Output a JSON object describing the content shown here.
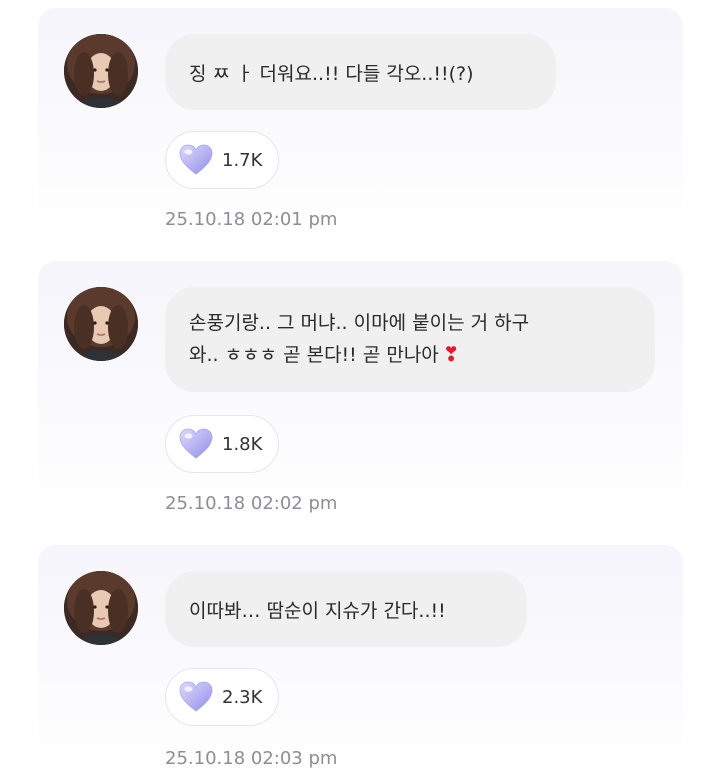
{
  "colors": {
    "card_background": "#f5f5fb",
    "bubble_background": "#f0f0f1",
    "timestamp_text": "#8e8e93",
    "reaction_heart": "#b7b4f4",
    "inline_heart": "#e8192c"
  },
  "messages": [
    {
      "lines": [
        "징 ㅉ ㅏ 더워요..!! 다들 각오..!!(?)"
      ],
      "reaction_icon": "lavender-heart-icon",
      "reaction_count": "1.7K",
      "timestamp": "25.10.18 02:01 pm"
    },
    {
      "lines": [
        "손풍기랑.. 그 머냐.. 이마에 붙이는 거 하구",
        "와.. ㅎㅎㅎ 곧 본다!! 곧 만나아"
      ],
      "trailing_emoji": "❣",
      "reaction_icon": "lavender-heart-icon",
      "reaction_count": "1.8K",
      "timestamp": "25.10.18 02:02 pm"
    },
    {
      "lines": [
        "이따봐… 땀순이 지슈가 간다..!!"
      ],
      "reaction_icon": "lavender-heart-icon",
      "reaction_count": "2.3K",
      "timestamp": "25.10.18 02:03 pm"
    }
  ]
}
